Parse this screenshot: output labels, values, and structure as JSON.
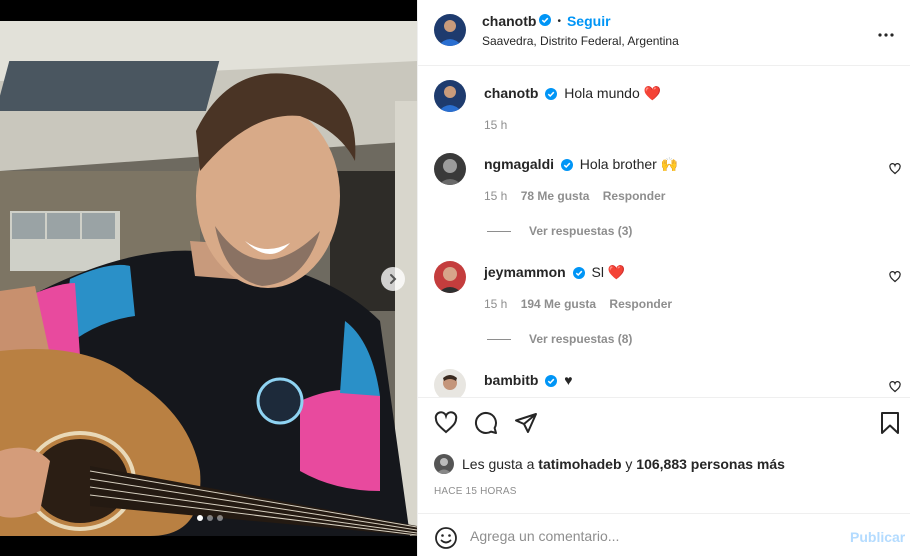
{
  "post": {
    "author": "chanotb",
    "follow_label": "Seguir",
    "separator": "•",
    "location": "Saavedra, Distrito Federal, Argentina"
  },
  "caption": {
    "user": "chanotb",
    "text": "Hola mundo",
    "emoji": "❤️",
    "time": "15 h"
  },
  "comments": [
    {
      "user": "ngmagaldi",
      "text": "Hola brother 🙌",
      "time": "15 h",
      "likes": "78 Me gusta",
      "reply": "Responder",
      "replies": "Ver respuestas (3)"
    },
    {
      "user": "jeymammon",
      "text": "Sl",
      "emoji": "❤️",
      "time": "15 h",
      "likes": "194 Me gusta",
      "reply": "Responder",
      "replies": "Ver respuestas (8)"
    },
    {
      "user": "bambitb",
      "text": "♥"
    }
  ],
  "likes_line": {
    "prefix": "Les gusta a",
    "user": "tatimohadeb",
    "middle": "y",
    "count": "106,883 personas más"
  },
  "posted_time": "HACE 15 HORAS",
  "comment_box": {
    "placeholder": "Agrega un comentario...",
    "post_label": "Publicar"
  },
  "colors": {
    "accent": "#0095f6",
    "verified": "#0095f6",
    "heart": "#ed4956",
    "muted": "#8e8e8e"
  },
  "media": {
    "slides": 3,
    "active_slide": 1
  }
}
